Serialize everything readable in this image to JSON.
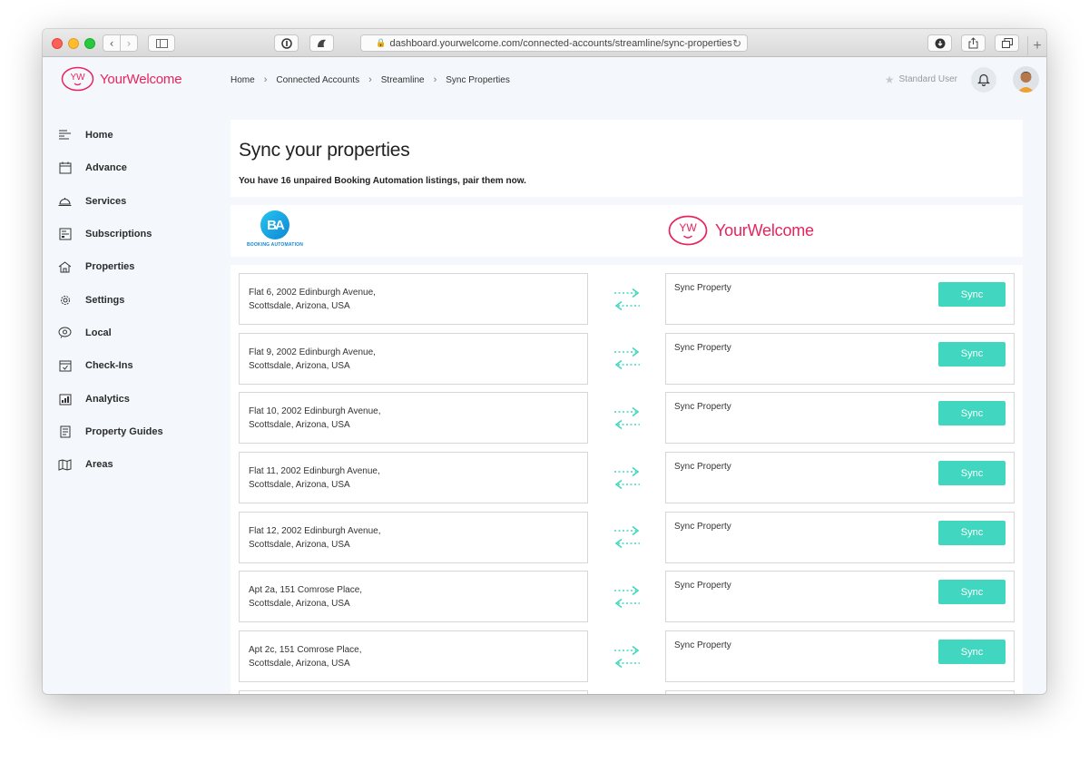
{
  "browser": {
    "url": "dashboard.yourwelcome.com/connected-accounts/streamline/sync-properties",
    "newtab_label": "+"
  },
  "brand": {
    "name": "YourWelcome",
    "mark": "YW",
    "color": "#e8245c"
  },
  "breadcrumb": [
    {
      "label": "Home"
    },
    {
      "label": "Connected Accounts"
    },
    {
      "label": "Streamline"
    },
    {
      "label": "Sync Properties"
    }
  ],
  "user": {
    "role": "Standard User"
  },
  "nav": {
    "items": [
      {
        "label": "Home",
        "icon": "home-icon"
      },
      {
        "label": "Advance",
        "icon": "calendar-icon"
      },
      {
        "label": "Services",
        "icon": "service-bell-icon"
      },
      {
        "label": "Subscriptions",
        "icon": "subscriptions-icon"
      },
      {
        "label": "Properties",
        "icon": "house-icon"
      },
      {
        "label": "Settings",
        "icon": "gear-icon"
      },
      {
        "label": "Local",
        "icon": "local-icon"
      },
      {
        "label": "Check-Ins",
        "icon": "check-calendar-icon"
      },
      {
        "label": "Analytics",
        "icon": "analytics-icon"
      },
      {
        "label": "Property Guides",
        "icon": "guide-icon"
      },
      {
        "label": "Areas",
        "icon": "map-icon"
      }
    ]
  },
  "page": {
    "title": "Sync your properties",
    "subtitle": "You have 16 unpaired Booking Automation listings, pair them now."
  },
  "partner": {
    "name": "BOOKING AUTOMATION",
    "mark": "BA",
    "color": "#0d87d6"
  },
  "sync_label": "Sync Property",
  "sync_button": "Sync",
  "accent": "#41d6bf",
  "rows": [
    {
      "line1": "Flat 6, 2002 Edinburgh Avenue,",
      "line2": "Scottsdale, Arizona, USA"
    },
    {
      "line1": "Flat 9, 2002 Edinburgh Avenue,",
      "line2": "Scottsdale, Arizona, USA"
    },
    {
      "line1": "Flat 10, 2002 Edinburgh Avenue,",
      "line2": "Scottsdale, Arizona, USA"
    },
    {
      "line1": "Flat 11, 2002 Edinburgh Avenue,",
      "line2": "Scottsdale, Arizona, USA"
    },
    {
      "line1": "Flat 12, 2002 Edinburgh Avenue,",
      "line2": "Scottsdale, Arizona, USA"
    },
    {
      "line1": "Apt 2a, 151 Comrose Place,",
      "line2": "Scottsdale, Arizona, USA"
    },
    {
      "line1": "Apt 2c, 151 Comrose Place,",
      "line2": "Scottsdale, Arizona, USA"
    },
    {
      "line1": "",
      "line2": ""
    }
  ]
}
